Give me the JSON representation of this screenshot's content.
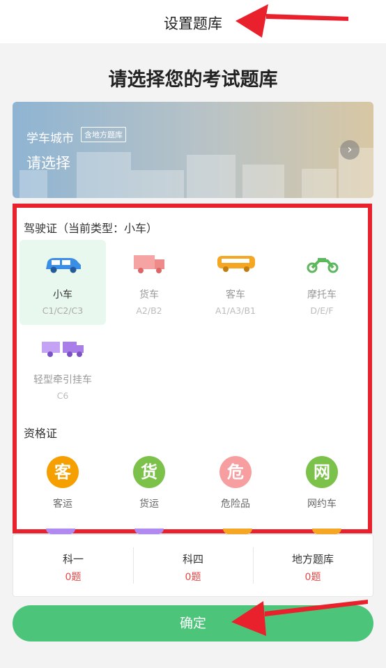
{
  "header": {
    "title": "设置题库"
  },
  "page_title": "请选择您的考试题库",
  "banner": {
    "city_label": "学车城市",
    "tag": "含地方题库",
    "choose": "请选择",
    "arrow": "›"
  },
  "driving": {
    "title": "驾驶证（当前类型：小车）",
    "items": [
      {
        "name": "小车",
        "code": "C1/C2/C3",
        "icon": "car-icon",
        "color": "#3a8ee6"
      },
      {
        "name": "货车",
        "code": "A2/B2",
        "icon": "truck-icon",
        "color": "#f28b8b"
      },
      {
        "name": "客车",
        "code": "A1/A3/B1",
        "icon": "bus-icon",
        "color": "#f5a623"
      },
      {
        "name": "摩托车",
        "code": "D/E/F",
        "icon": "motorcycle-icon",
        "color": "#5cb85c"
      },
      {
        "name": "轻型牵引挂车",
        "code": "C6",
        "icon": "trailer-icon",
        "color": "#a97ee8"
      }
    ]
  },
  "qualification": {
    "title": "资格证",
    "items": [
      {
        "char": "客",
        "label": "客运",
        "color": "#f5a000"
      },
      {
        "char": "货",
        "label": "货运",
        "color": "#7cc14a"
      },
      {
        "char": "危",
        "label": "危险品",
        "color": "#f79fa0"
      },
      {
        "char": "网",
        "label": "网约车",
        "color": "#7cc14a"
      }
    ]
  },
  "counts": [
    {
      "label": "科一",
      "value": "0题"
    },
    {
      "label": "科四",
      "value": "0题"
    },
    {
      "label": "地方题库",
      "value": "0题"
    }
  ],
  "confirm_label": "确定",
  "colors": {
    "accent_green": "#4cc47a",
    "highlight_red": "#e8212c",
    "count_red": "#e84848"
  }
}
